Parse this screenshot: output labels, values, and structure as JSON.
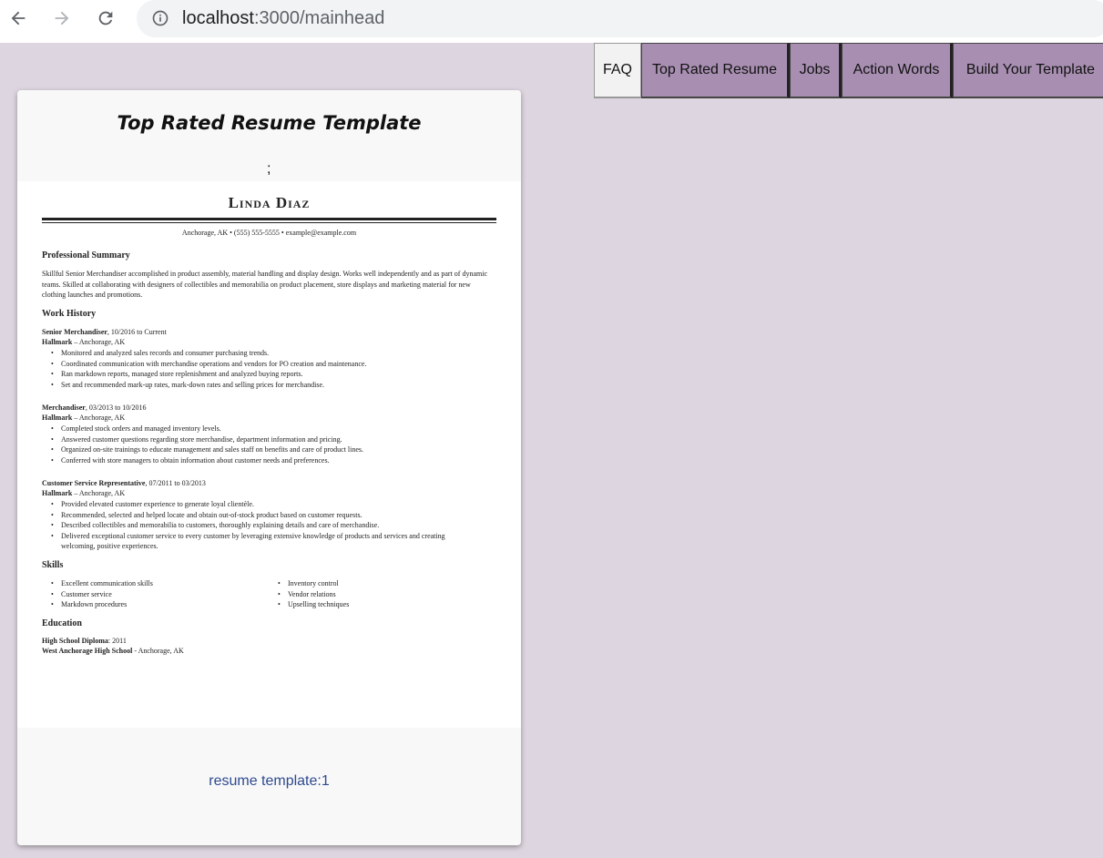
{
  "browser": {
    "url_host": "localhost",
    "url_path": ":3000/mainhead"
  },
  "nav": {
    "faq": "FAQ",
    "top_rated": "Top Rated Resume",
    "jobs": "Jobs",
    "action_words": "Action Words",
    "build_template": "Build Your Template"
  },
  "card": {
    "title": "Top Rated Resume Template",
    "semicolon": ";",
    "footer": "resume template:1"
  },
  "resume": {
    "name": "Linda Diaz",
    "contact": "Anchorage, AK  •  (555) 555-5555  •  example@example.com",
    "summary_heading": "Professional Summary",
    "summary": "Skillful Senior Merchandiser accomplished in product assembly, material handling and display design. Works well independently and as part of dynamic teams. Skilled at collaborating with designers of collectibles and memorabilia on product placement, store displays and marketing material for new clothing launches and promotions.",
    "work_heading": "Work History",
    "jobs": [
      {
        "title": "Senior Merchandiser",
        "dates": ", 10/2016 to Current",
        "company": "Hallmark",
        "location": " – Anchorage, AK",
        "bullets": [
          "Monitored and analyzed sales records and consumer purchasing trends.",
          "Coordinated communication with merchandise operations and vendors for PO creation and maintenance.",
          "Ran markdown reports, managed store replenishment and analyzed buying reports.",
          "Set and recommended mark-up rates, mark-down rates and selling prices for merchandise."
        ]
      },
      {
        "title": "Merchandiser",
        "dates": ", 03/2013 to 10/2016",
        "company": "Hallmark",
        "location": " – Anchorage, AK",
        "bullets": [
          "Completed stock orders and managed inventory levels.",
          "Answered customer questions regarding store merchandise, department information and pricing.",
          "Organized on-site trainings to educate management and sales staff on benefits and care of product lines.",
          "Conferred with store managers to obtain information about customer needs and preferences."
        ]
      },
      {
        "title": "Customer Service Representative",
        "dates": ", 07/2011 to 03/2013",
        "company": "Hallmark",
        "location": " – Anchorage, AK",
        "bullets": [
          "Provided elevated customer experience to generate loyal clientèle.",
          "Recommended, selected and helped locate and obtain out-of-stock product based on customer requests.",
          "Described collectibles and memorabilia to customers, thoroughly explaining details and care of merchandise.",
          "Delivered exceptional customer service to every customer by leveraging extensive knowledge of products and services and creating welcoming, positive experiences."
        ]
      }
    ],
    "skills_heading": "Skills",
    "skills_left": [
      "Excellent communication skills",
      "Customer service",
      "Markdown procedures"
    ],
    "skills_right": [
      "Inventory control",
      "Vendor relations",
      "Upselling techniques"
    ],
    "education_heading": "Education",
    "edu1_bold": "High School Diploma",
    "edu1_rest": ": 2011",
    "edu2_bold": "West Anchorage High School",
    "edu2_rest": " - Anchorage, AK"
  }
}
